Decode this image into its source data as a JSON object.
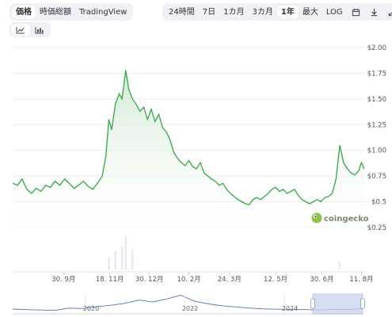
{
  "tabs": {
    "items": [
      "価格",
      "時価総額",
      "TradingView"
    ],
    "active": 0
  },
  "ranges": {
    "items": [
      "24時間",
      "7日",
      "1カ月",
      "3カ月",
      "1年",
      "最大",
      "LOG"
    ],
    "active": 4
  },
  "chart_type_icons": [
    "line-chart-icon",
    "candlestick-chart-icon"
  ],
  "toolbar_icons": [
    "calendar-icon",
    "download-icon",
    "fullscreen-icon"
  ],
  "watermark": "coingecko",
  "colors": {
    "line": "#3aa34a",
    "fill": "#e6f4e8",
    "volume": "#e8e9ee",
    "navigator": "#5b6fb0"
  },
  "chart_data": {
    "type": "area",
    "ylim": [
      0.18,
      2.0
    ],
    "yticks": [
      {
        "value": 2.0,
        "label": "$2.00"
      },
      {
        "value": 1.75,
        "label": "$1.75"
      },
      {
        "value": 1.5,
        "label": "$1.50"
      },
      {
        "value": 1.25,
        "label": "$1.25"
      },
      {
        "value": 1.0,
        "label": "$1.00"
      },
      {
        "value": 0.75,
        "label": "$0.75"
      },
      {
        "value": 0.5,
        "label": "$0.5"
      },
      {
        "value": 0.25,
        "label": "$0.25"
      }
    ],
    "xlim": [
      "2023-08-07",
      "2024-08-14"
    ],
    "xticks": [
      {
        "date": "2023-09-30",
        "label": "30. 9月"
      },
      {
        "date": "2023-11-18",
        "label": "18. 11月"
      },
      {
        "date": "2023-12-30",
        "label": "30. 12月"
      },
      {
        "date": "2024-02-10",
        "label": "10. 2月"
      },
      {
        "date": "2024-03-24",
        "label": "24. 3月"
      },
      {
        "date": "2024-05-12",
        "label": "12. 5月"
      },
      {
        "date": "2024-06-30",
        "label": "30. 6月"
      },
      {
        "date": "2024-08-11",
        "label": "11. 8月"
      }
    ],
    "series": [
      {
        "points": [
          [
            "2023-08-07",
            0.68
          ],
          [
            "2023-08-12",
            0.66
          ],
          [
            "2023-08-17",
            0.72
          ],
          [
            "2023-08-22",
            0.62
          ],
          [
            "2023-08-27",
            0.58
          ],
          [
            "2023-09-01",
            0.63
          ],
          [
            "2023-09-06",
            0.6
          ],
          [
            "2023-09-11",
            0.66
          ],
          [
            "2023-09-16",
            0.64
          ],
          [
            "2023-09-21",
            0.7
          ],
          [
            "2023-09-26",
            0.66
          ],
          [
            "2023-10-01",
            0.72
          ],
          [
            "2023-10-06",
            0.68
          ],
          [
            "2023-10-11",
            0.63
          ],
          [
            "2023-10-16",
            0.66
          ],
          [
            "2023-10-21",
            0.7
          ],
          [
            "2023-10-26",
            0.65
          ],
          [
            "2023-10-31",
            0.62
          ],
          [
            "2023-11-05",
            0.68
          ],
          [
            "2023-11-10",
            0.75
          ],
          [
            "2023-11-14",
            0.95
          ],
          [
            "2023-11-17",
            1.3
          ],
          [
            "2023-11-20",
            1.2
          ],
          [
            "2023-11-24",
            1.45
          ],
          [
            "2023-11-28",
            1.55
          ],
          [
            "2023-12-01",
            1.5
          ],
          [
            "2023-12-05",
            1.78
          ],
          [
            "2023-12-08",
            1.6
          ],
          [
            "2023-12-12",
            1.5
          ],
          [
            "2023-12-16",
            1.45
          ],
          [
            "2023-12-20",
            1.38
          ],
          [
            "2023-12-24",
            1.42
          ],
          [
            "2023-12-28",
            1.3
          ],
          [
            "2024-01-01",
            1.4
          ],
          [
            "2024-01-05",
            1.28
          ],
          [
            "2024-01-09",
            1.35
          ],
          [
            "2024-01-13",
            1.22
          ],
          [
            "2024-01-17",
            1.18
          ],
          [
            "2024-01-21",
            1.1
          ],
          [
            "2024-01-25",
            0.98
          ],
          [
            "2024-01-29",
            0.92
          ],
          [
            "2024-02-02",
            0.88
          ],
          [
            "2024-02-06",
            0.85
          ],
          [
            "2024-02-10",
            0.9
          ],
          [
            "2024-02-14",
            0.84
          ],
          [
            "2024-02-18",
            0.82
          ],
          [
            "2024-02-22",
            0.88
          ],
          [
            "2024-02-26",
            0.78
          ],
          [
            "2024-03-01",
            0.75
          ],
          [
            "2024-03-05",
            0.72
          ],
          [
            "2024-03-09",
            0.7
          ],
          [
            "2024-03-13",
            0.66
          ],
          [
            "2024-03-17",
            0.68
          ],
          [
            "2024-03-21",
            0.62
          ],
          [
            "2024-03-25",
            0.58
          ],
          [
            "2024-03-29",
            0.55
          ],
          [
            "2024-04-02",
            0.52
          ],
          [
            "2024-04-06",
            0.5
          ],
          [
            "2024-04-10",
            0.48
          ],
          [
            "2024-04-14",
            0.47
          ],
          [
            "2024-04-18",
            0.52
          ],
          [
            "2024-04-22",
            0.54
          ],
          [
            "2024-04-26",
            0.52
          ],
          [
            "2024-04-30",
            0.55
          ],
          [
            "2024-05-04",
            0.58
          ],
          [
            "2024-05-08",
            0.62
          ],
          [
            "2024-05-12",
            0.64
          ],
          [
            "2024-05-16",
            0.6
          ],
          [
            "2024-05-20",
            0.62
          ],
          [
            "2024-05-24",
            0.58
          ],
          [
            "2024-05-28",
            0.6
          ],
          [
            "2024-06-01",
            0.62
          ],
          [
            "2024-06-05",
            0.56
          ],
          [
            "2024-06-09",
            0.52
          ],
          [
            "2024-06-13",
            0.5
          ],
          [
            "2024-06-17",
            0.48
          ],
          [
            "2024-06-21",
            0.5
          ],
          [
            "2024-06-25",
            0.52
          ],
          [
            "2024-06-29",
            0.5
          ],
          [
            "2024-07-03",
            0.54
          ],
          [
            "2024-07-07",
            0.55
          ],
          [
            "2024-07-11",
            0.58
          ],
          [
            "2024-07-15",
            0.72
          ],
          [
            "2024-07-19",
            1.05
          ],
          [
            "2024-07-23",
            0.88
          ],
          [
            "2024-07-27",
            0.82
          ],
          [
            "2024-07-31",
            0.78
          ],
          [
            "2024-08-04",
            0.76
          ],
          [
            "2024-08-08",
            0.8
          ],
          [
            "2024-08-11",
            0.88
          ],
          [
            "2024-08-14",
            0.82
          ]
        ]
      }
    ],
    "volume": [
      [
        "2023-11-17",
        0.35
      ],
      [
        "2023-11-24",
        0.55
      ],
      [
        "2023-12-01",
        0.7
      ],
      [
        "2023-12-05",
        1.0
      ],
      [
        "2023-12-12",
        0.6
      ],
      [
        "2024-07-19",
        0.25
      ]
    ],
    "navigator": {
      "xticks": [
        "2020",
        "2022",
        "2024"
      ],
      "values": [
        0.25,
        0.22,
        0.2,
        0.18,
        0.3,
        0.28,
        0.38,
        0.45,
        0.55,
        0.72,
        0.62,
        0.78,
        0.98,
        0.66,
        0.52,
        0.42,
        0.36,
        0.3,
        0.26,
        0.24,
        0.22,
        0.22,
        0.2,
        0.24,
        0.22,
        0.28
      ]
    }
  }
}
